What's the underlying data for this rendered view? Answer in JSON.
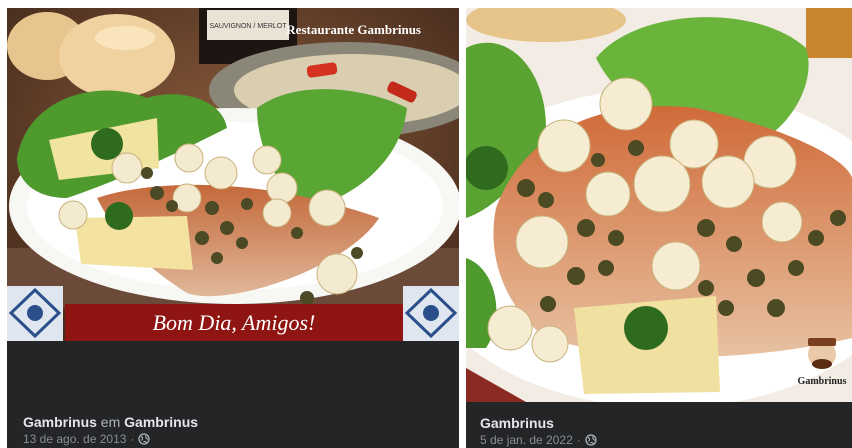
{
  "posts": [
    {
      "image": {
        "alt": "Fish fillet with capers, mushrooms, potatoes and lettuce",
        "restaurant_sign": "Restaurante Gambrinus",
        "wine_label": "SAUVIGNON / MERLOT",
        "banner_text": "Bom Dia, Amigos!"
      },
      "author": "Gambrinus",
      "joiner": "em",
      "location": "Gambrinus",
      "date": "13 de ago. de 2013",
      "separator": "·",
      "audience_icon": "globe-icon"
    },
    {
      "image": {
        "alt": "Fish fillet with capers, mushrooms, potatoes and lettuce (close-up)",
        "logo_text": "Gambrinus"
      },
      "author": "Gambrinus",
      "date": "5 de jan. de 2022",
      "separator": "·",
      "audience_icon": "globe-icon"
    }
  ],
  "colors": {
    "card_bg": "#242526",
    "text_primary": "#e4e6eb",
    "text_secondary": "#8a8d91",
    "banner_red": "#8e1512"
  }
}
